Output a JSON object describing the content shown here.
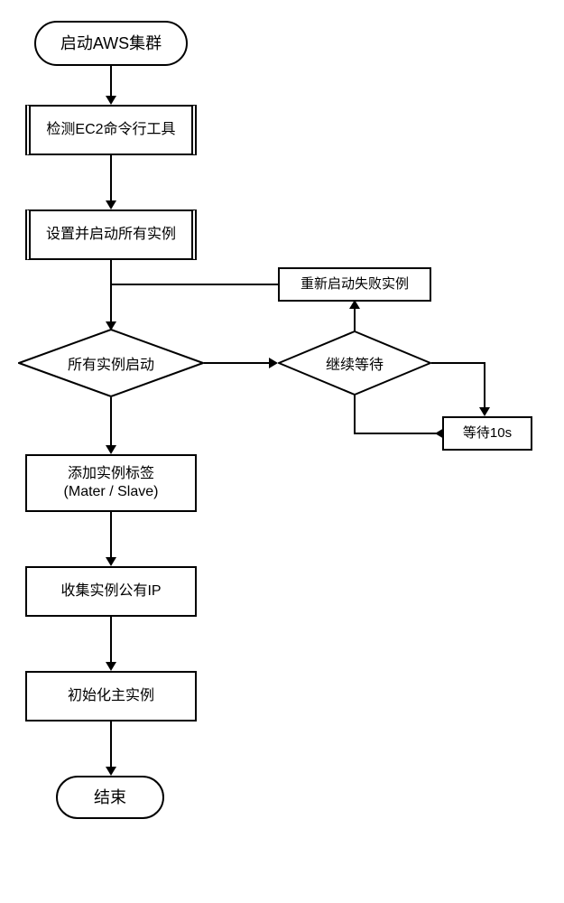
{
  "start": "启动AWS集群",
  "step1": "检测EC2命令行工具",
  "step2": "设置并启动所有实例",
  "decision1": "所有实例启动",
  "decision2": "继续等待",
  "retry": "重新启动失败实例",
  "wait": "等待10s",
  "step3_line1": "添加实例标签",
  "step3_line2": "(Mater / Slave)",
  "step4": "收集实例公有IP",
  "step5": "初始化主实例",
  "end": "结束"
}
